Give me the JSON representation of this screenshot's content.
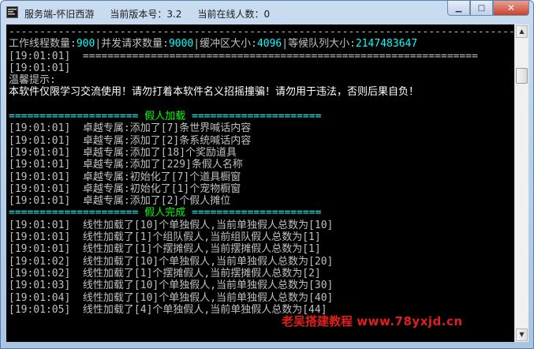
{
  "window": {
    "app_name": "服务端-怀旧西游",
    "version_label": "当前版本号：3.2",
    "online_label": "当前在线人数：0"
  },
  "console": {
    "lines": [
      {
        "kind": "plain",
        "text": "----------------------------------------------------------------------------------------"
      },
      {
        "kind": "stats",
        "parts": [
          {
            "t": "工作线程数量:",
            "c": "plain"
          },
          {
            "t": "900",
            "c": "cyan"
          },
          {
            "t": "|并发请求数量:",
            "c": "plain"
          },
          {
            "t": "9000",
            "c": "cyan"
          },
          {
            "t": "|缓冲区大小:",
            "c": "plain"
          },
          {
            "t": "4096",
            "c": "cyan"
          },
          {
            "t": "|等候队列大小:",
            "c": "plain"
          },
          {
            "t": "2147483647",
            "c": "cyan"
          }
        ]
      },
      {
        "kind": "plain",
        "text": "[19:01:01]  ================================================================"
      },
      {
        "kind": "plain",
        "text": "[19:01:01]"
      },
      {
        "kind": "plain",
        "text": "温馨提示:"
      },
      {
        "kind": "hl",
        "text": "本软件仅限学习交流使用！请勿打着本软件名义招摇撞骗！请勿用于违法，否则后果自负！"
      },
      {
        "kind": "plain",
        "text": ""
      },
      {
        "kind": "section",
        "parts": [
          {
            "t": "=====================",
            "c": "cyan"
          },
          {
            "t": " 假人加载 ",
            "c": "green"
          },
          {
            "t": "=====================",
            "c": "cyan"
          }
        ]
      },
      {
        "kind": "plain",
        "text": "[19:01:01]  卓越专属:添加了[7]条世界喊话内容"
      },
      {
        "kind": "plain",
        "text": "[19:01:01]  卓越专属:添加了[2]条系统喊话内容"
      },
      {
        "kind": "plain",
        "text": "[19:01:01]  卓越专属:添加了[18]个奖励道具"
      },
      {
        "kind": "plain",
        "text": "[19:01:01]  卓越专属:添加了[229]条假人名称"
      },
      {
        "kind": "plain",
        "text": "[19:01:01]  卓越专属:初始化了[7]个道具橱窗"
      },
      {
        "kind": "plain",
        "text": "[19:01:01]  卓越专属:初始化了[1]个宠物橱窗"
      },
      {
        "kind": "plain",
        "text": "[19:01:01]  卓越专属:添加了[2]个假人摊位"
      },
      {
        "kind": "section",
        "parts": [
          {
            "t": "=====================",
            "c": "cyan"
          },
          {
            "t": " 假人完成 ",
            "c": "green"
          },
          {
            "t": "=====================",
            "c": "cyan"
          }
        ]
      },
      {
        "kind": "plain",
        "text": "[19:01:01]  线性加载了[10]个单独假人,当前单独假人总数为[10]"
      },
      {
        "kind": "plain",
        "text": "[19:01:01]  线性加载了[1]个组队假人,当前组队假人总数为[1]"
      },
      {
        "kind": "plain",
        "text": "[19:01:01]  线性加载了[1]个摆摊假人,当前摆摊假人总数为[1]"
      },
      {
        "kind": "plain",
        "text": "[19:01:02]  线性加载了[10]个单独假人,当前单独假人总数为[20]"
      },
      {
        "kind": "plain",
        "text": "[19:01:02]  线性加载了[1]个摆摊假人,当前摆摊假人总数为[2]"
      },
      {
        "kind": "plain",
        "text": "[19:01:03]  线性加载了[10]个单独假人,当前单独假人总数为[30]"
      },
      {
        "kind": "plain",
        "text": "[19:01:04]  线性加载了[10]个单独假人,当前单独假人总数为[40]"
      },
      {
        "kind": "plain",
        "text": "[19:01:05]  线性加载了[4]个单独假人,当前单独假人总数为[44]"
      }
    ]
  },
  "watermark": {
    "cn": "老吴搭建教程",
    "url": "www.78yxjd.cn"
  },
  "colors": {
    "console_bg": "#000000",
    "text": "#c0c0c0",
    "highlight": "#00ffff",
    "section": "#00ff00",
    "watermark": "#e0201a"
  },
  "icons": {
    "minimize": "minimize-icon",
    "maximize": "maximize-icon",
    "close": "close-icon",
    "app": "app-icon"
  }
}
